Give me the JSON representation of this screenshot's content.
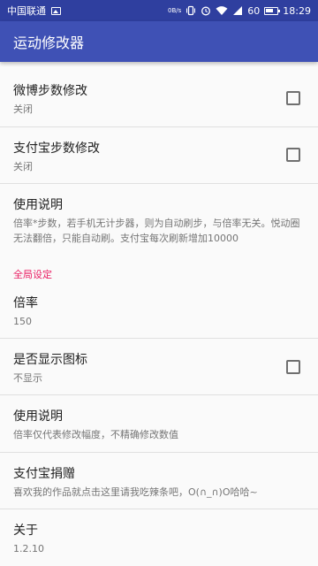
{
  "status_bar": {
    "carrier": "中国联通",
    "net_speed": "0B/s",
    "battery": "60",
    "time": "18:29"
  },
  "app_bar": {
    "title": "运动修改器"
  },
  "prefs": {
    "weibo": {
      "title": "微博步数修改",
      "summary": "关闭",
      "checked": false
    },
    "alipay": {
      "title": "支付宝步数修改",
      "summary": "关闭",
      "checked": false
    },
    "usage1": {
      "title": "使用说明",
      "summary": "倍率*步数，若手机无计步器，则为自动刷步，与倍率无关。悦动圈无法翻倍，只能自动刷。支付宝每次刷新增加10000"
    },
    "section": "全局设定",
    "rate": {
      "title": "倍率",
      "summary": "150"
    },
    "show_icon": {
      "title": "是否显示图标",
      "summary": "不显示",
      "checked": false
    },
    "usage2": {
      "title": "使用说明",
      "summary": "倍率仅代表修改幅度，不精确修改数值"
    },
    "donate": {
      "title": "支付宝捐赠",
      "summary": "喜欢我的作品就点击这里请我吃辣条吧，O(∩_∩)O哈哈~"
    },
    "about": {
      "title": "关于",
      "summary": "1.2.10"
    }
  }
}
